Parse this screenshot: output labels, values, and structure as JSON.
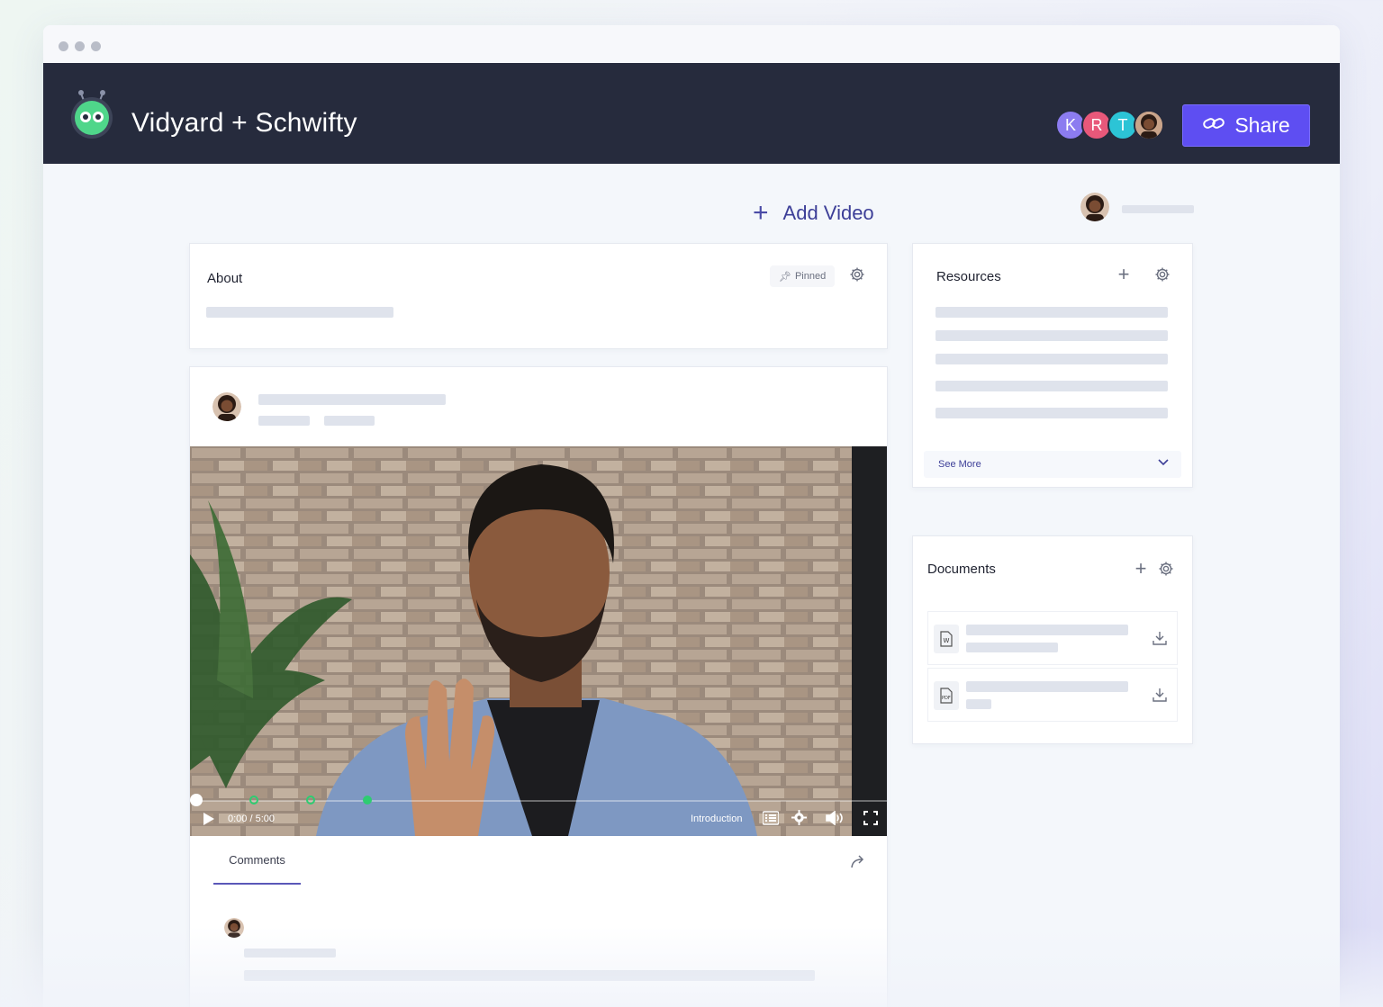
{
  "app": {
    "title": "Vidyard + Schwifty",
    "share_label": "Share"
  },
  "collaborators": [
    {
      "initial": "K",
      "color": "#8c7cf0"
    },
    {
      "initial": "R",
      "color": "#e8587a"
    },
    {
      "initial": "T",
      "color": "#2cc4d6"
    },
    {
      "initial": "",
      "color": "#3a2a22"
    }
  ],
  "toolbar": {
    "add_video_label": "Add Video"
  },
  "about": {
    "title": "About",
    "pinned_label": "Pinned"
  },
  "video": {
    "time": "0:00 / 5:00",
    "chapter": "Introduction",
    "progress": 0
  },
  "tabs": {
    "comments_label": "Comments"
  },
  "resources": {
    "title": "Resources",
    "see_more_label": "See More"
  },
  "documents": {
    "title": "Documents",
    "files": [
      {
        "type": "W"
      },
      {
        "type": "PDF"
      }
    ]
  },
  "colors": {
    "header_bg": "#262b3d",
    "accent": "#5e4ef2",
    "link": "#3d3f98",
    "chapter_marker": "#2ecc71"
  }
}
